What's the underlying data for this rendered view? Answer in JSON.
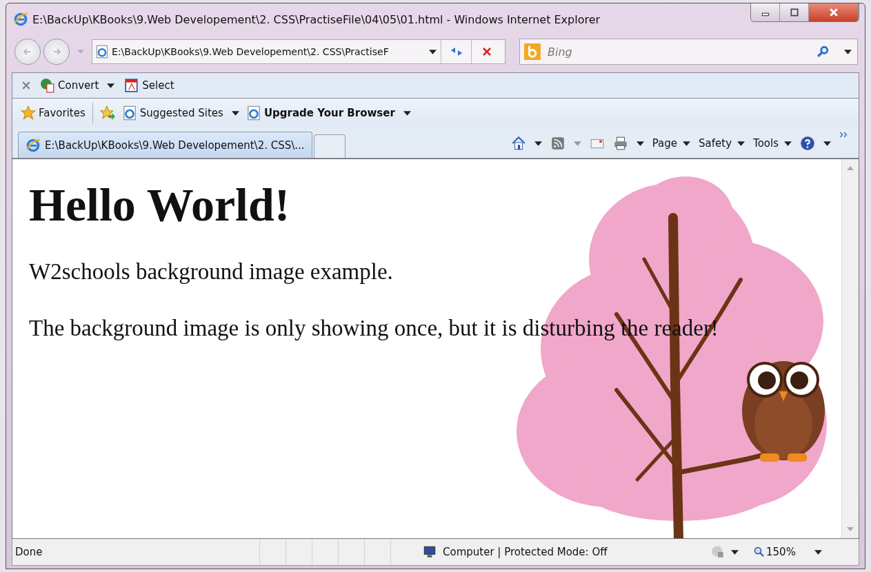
{
  "window": {
    "title": "E:\\BackUp\\KBooks\\9.Web Developement\\2. CSS\\PractiseFile\\04\\05\\01.html - Windows Internet Explorer"
  },
  "address_bar": {
    "value": "E:\\BackUp\\KBooks\\9.Web Developement\\2. CSS\\PractiseF"
  },
  "search": {
    "placeholder": "Bing"
  },
  "pdf_toolbar": {
    "items": [
      {
        "label": "Convert",
        "kind": "dropdown"
      },
      {
        "label": "Select",
        "kind": "button"
      }
    ]
  },
  "favorites_bar": {
    "favorites": "Favorites",
    "items": [
      {
        "label": "Suggested Sites",
        "bold": false
      },
      {
        "label": "Upgrade Your Browser",
        "bold": true
      }
    ]
  },
  "tabs": [
    {
      "label": "E:\\BackUp\\KBooks\\9.Web Developement\\2. CSS\\...",
      "selected": true
    }
  ],
  "command_bar": {
    "menus": [
      "Page",
      "Safety",
      "Tools"
    ]
  },
  "page": {
    "heading": "Hello World!",
    "paragraphs": [
      "W2schools background image example.",
      "The background image is only showing once, but it is disturbing the reader!"
    ]
  },
  "status_bar": {
    "status": "Done",
    "zone": "Computer | Protected Mode: Off",
    "zoom": "150%"
  }
}
